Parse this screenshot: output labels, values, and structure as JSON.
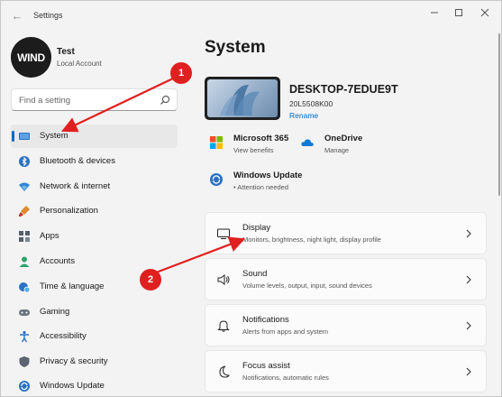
{
  "window": {
    "title": "Settings"
  },
  "user": {
    "avatar_text": "WIND",
    "name": "Test",
    "account_type": "Local Account"
  },
  "search": {
    "placeholder": "Find a setting"
  },
  "sidebar": {
    "items": [
      {
        "label": "System",
        "icon": "monitor-icon",
        "active": true
      },
      {
        "label": "Bluetooth & devices",
        "icon": "bluetooth-icon"
      },
      {
        "label": "Network & internet",
        "icon": "wifi-icon"
      },
      {
        "label": "Personalization",
        "icon": "brush-icon"
      },
      {
        "label": "Apps",
        "icon": "apps-icon"
      },
      {
        "label": "Accounts",
        "icon": "person-icon"
      },
      {
        "label": "Time & language",
        "icon": "globe-clock-icon"
      },
      {
        "label": "Gaming",
        "icon": "gamepad-icon"
      },
      {
        "label": "Accessibility",
        "icon": "accessibility-icon"
      },
      {
        "label": "Privacy & security",
        "icon": "shield-icon"
      },
      {
        "label": "Windows Update",
        "icon": "update-icon"
      }
    ]
  },
  "main": {
    "title": "System",
    "device": {
      "name": "DESKTOP-7EDUE9T",
      "model": "20L5508K00",
      "rename_label": "Rename"
    },
    "quick_tiles": [
      {
        "title": "Microsoft 365",
        "subtitle": "View benefits",
        "icon": "microsoft-logo-icon"
      },
      {
        "title": "OneDrive",
        "subtitle": "Manage",
        "icon": "cloud-icon"
      },
      {
        "title": "Windows Update",
        "subtitle": "• Attention needed",
        "icon": "update-icon"
      }
    ],
    "cards": [
      {
        "title": "Display",
        "subtitle": "Monitors, brightness, night light, display profile",
        "icon": "display-icon"
      },
      {
        "title": "Sound",
        "subtitle": "Volume levels, output, input, sound devices",
        "icon": "speaker-icon"
      },
      {
        "title": "Notifications",
        "subtitle": "Alerts from apps and system",
        "icon": "bell-icon"
      },
      {
        "title": "Focus assist",
        "subtitle": "Notifications, automatic rules",
        "icon": "moon-icon"
      }
    ]
  },
  "annotations": {
    "badge_1": "1",
    "badge_2": "2"
  },
  "colors": {
    "accent": "#0067c0",
    "annotation_red": "#e02020",
    "background": "#f3f3f3"
  }
}
